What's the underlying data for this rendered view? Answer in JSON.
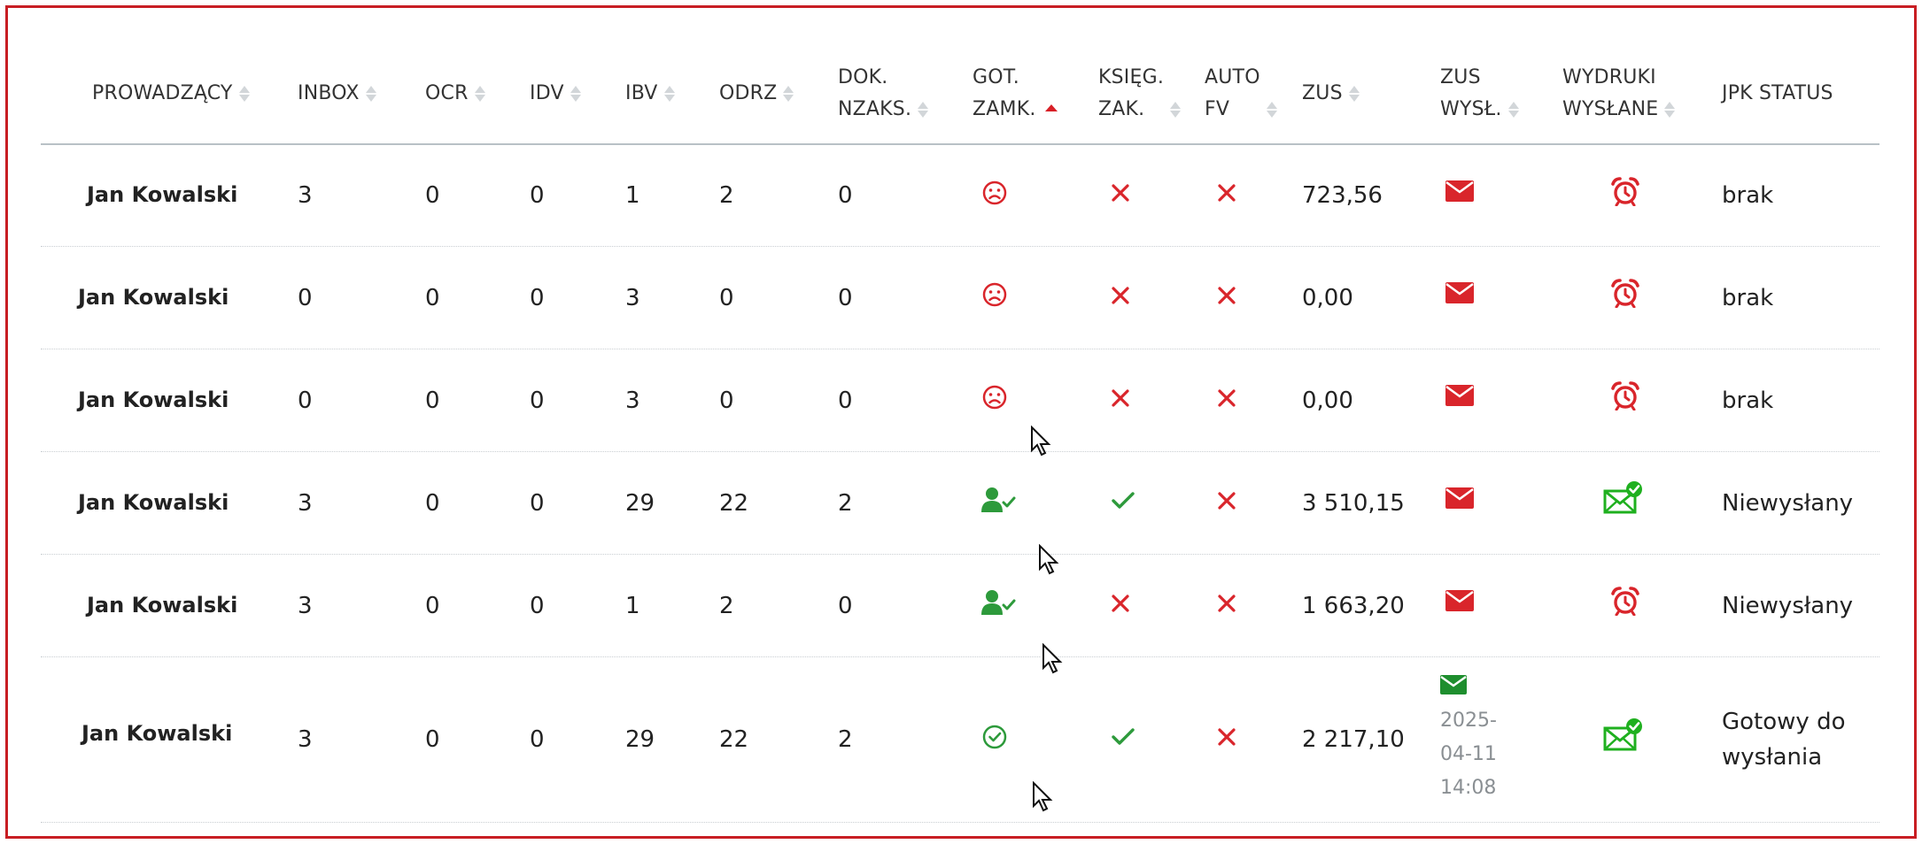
{
  "colors": {
    "frame": "#c81e24",
    "red": "#d9252b",
    "green": "#2d9a3b",
    "muted": "#8a8f93",
    "sort_active": "#d81f26"
  },
  "columns": [
    {
      "key": "prowadzacy",
      "label": "PROWADZĄCY",
      "sortable": true
    },
    {
      "key": "inbox",
      "label": "INBOX",
      "sortable": true
    },
    {
      "key": "ocr",
      "label": "OCR",
      "sortable": true
    },
    {
      "key": "idv",
      "label": "IDV",
      "sortable": true
    },
    {
      "key": "ibv",
      "label": "IBV",
      "sortable": true
    },
    {
      "key": "odrz",
      "label": "ODRZ",
      "sortable": true
    },
    {
      "key": "dok",
      "label1": "DOK.",
      "label2": "NZAKS.",
      "sortable": true
    },
    {
      "key": "got",
      "label1": "GOT.",
      "label2": "ZAMK.",
      "sortable": true,
      "sort_active": "asc"
    },
    {
      "key": "ksieg",
      "label1": "KSIĘG.",
      "label2": "ZAK.",
      "sortable": true
    },
    {
      "key": "autofv",
      "label1": "AUTO",
      "label2": "FV",
      "sortable": true
    },
    {
      "key": "zus",
      "label": "ZUS",
      "sortable": true
    },
    {
      "key": "zus_wysl",
      "label1": "ZUS",
      "label2": "WYSŁ.",
      "sortable": true
    },
    {
      "key": "wydruki",
      "label1": "WYDRUKI",
      "label2": "WYSŁANE",
      "sortable": true
    },
    {
      "key": "jpk",
      "label": "JPK STATUS",
      "sortable": false
    }
  ],
  "rows": [
    {
      "prowadzacy": "Jan Kowalski",
      "inbox": "3",
      "ocr": "0",
      "idv": "0",
      "ibv": "1",
      "odrz": "2",
      "dok": "0",
      "got_icon": "sad-face-icon",
      "ksieg_icon": "cross-icon",
      "autofv_icon": "cross-icon",
      "zus": "723,56",
      "zus_wysl_icon": "envelope-red-icon",
      "wydruki_icon": "alarm-clock-icon",
      "jpk": "brak"
    },
    {
      "prowadzacy": "Jan Kowalski",
      "inbox": "0",
      "ocr": "0",
      "idv": "0",
      "ibv": "3",
      "odrz": "0",
      "dok": "0",
      "got_icon": "sad-face-icon",
      "ksieg_icon": "cross-icon",
      "autofv_icon": "cross-icon",
      "zus": "0,00",
      "zus_wysl_icon": "envelope-red-icon",
      "wydruki_icon": "alarm-clock-icon",
      "jpk": "brak"
    },
    {
      "prowadzacy": "Jan Kowalski",
      "inbox": "0",
      "ocr": "0",
      "idv": "0",
      "ibv": "3",
      "odrz": "0",
      "dok": "0",
      "got_icon": "sad-face-icon",
      "ksieg_icon": "cross-icon",
      "autofv_icon": "cross-icon",
      "zus": "0,00",
      "zus_wysl_icon": "envelope-red-icon",
      "wydruki_icon": "alarm-clock-icon",
      "jpk": "brak"
    },
    {
      "prowadzacy": "Jan Kowalski",
      "inbox": "3",
      "ocr": "0",
      "idv": "0",
      "ibv": "29",
      "odrz": "22",
      "dok": "2",
      "got_icon": "user-check-icon",
      "ksieg_icon": "check-icon",
      "autofv_icon": "cross-icon",
      "zus": "3 510,15",
      "zus_wysl_icon": "envelope-red-icon",
      "wydruki_icon": "mail-sent-icon",
      "jpk": "Niewysłany"
    },
    {
      "prowadzacy": "Jan Kowalski",
      "inbox": "3",
      "ocr": "0",
      "idv": "0",
      "ibv": "1",
      "odrz": "2",
      "dok": "0",
      "got_icon": "user-check-icon",
      "ksieg_icon": "cross-icon",
      "autofv_icon": "cross-icon",
      "zus": "1 663,20",
      "zus_wysl_icon": "envelope-red-icon",
      "wydruki_icon": "alarm-clock-icon",
      "jpk": "Niewysłany"
    },
    {
      "prowadzacy": "Jan Kowalski",
      "inbox": "3",
      "ocr": "0",
      "idv": "0",
      "ibv": "29",
      "odrz": "22",
      "dok": "2",
      "got_icon": "check-circle-icon",
      "ksieg_icon": "check-icon",
      "autofv_icon": "cross-icon",
      "zus": "2 217,10",
      "zus_wysl_icon": "envelope-green-icon",
      "zus_wysl_date": [
        "2025-",
        "04-11",
        "14:08"
      ],
      "wydruki_icon": "mail-sent-icon",
      "jpk_lines": [
        "Gotowy do",
        "wysłania"
      ]
    }
  ]
}
